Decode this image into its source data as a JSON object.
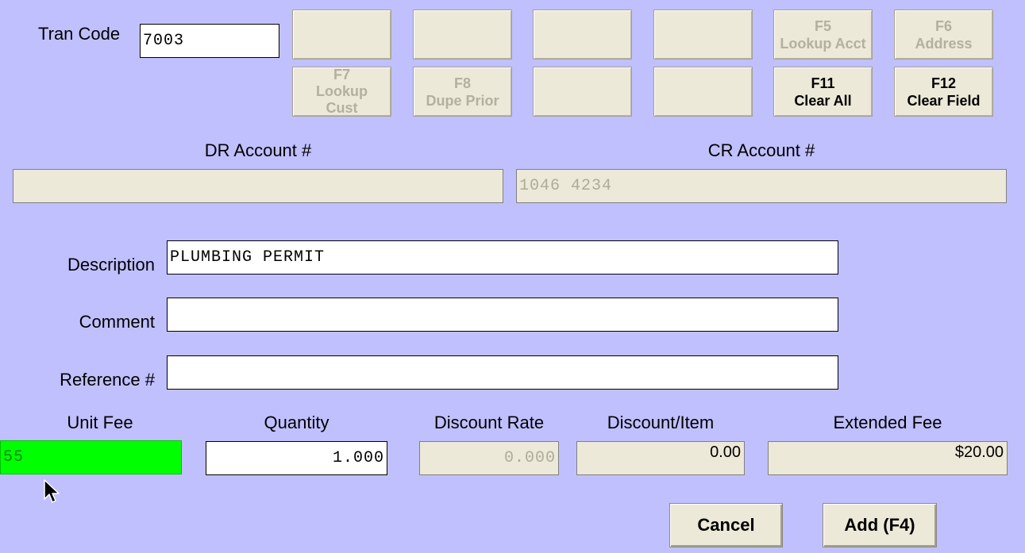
{
  "tran_code": {
    "label": "Tran Code",
    "value": "7003"
  },
  "function_keys": [
    {
      "key": "",
      "label": "",
      "enabled": false
    },
    {
      "key": "",
      "label": "",
      "enabled": false
    },
    {
      "key": "",
      "label": "",
      "enabled": false
    },
    {
      "key": "",
      "label": "",
      "enabled": false
    },
    {
      "key": "F5",
      "label": "Lookup Acct",
      "enabled": false
    },
    {
      "key": "F6",
      "label": "Address",
      "enabled": false
    },
    {
      "key": "F7",
      "label": "Lookup Cust",
      "enabled": false
    },
    {
      "key": "F8",
      "label": "Dupe Prior",
      "enabled": false
    },
    {
      "key": "",
      "label": "",
      "enabled": false
    },
    {
      "key": "",
      "label": "",
      "enabled": false
    },
    {
      "key": "F11",
      "label": "Clear All",
      "enabled": true
    },
    {
      "key": "F12",
      "label": "Clear Field",
      "enabled": true
    }
  ],
  "accounts": {
    "dr_label": "DR Account #",
    "dr_value": "",
    "cr_label": "CR Account #",
    "cr_value": "1046 4234"
  },
  "form": {
    "description_label": "Description",
    "description_value": "PLUMBING PERMIT",
    "comment_label": "Comment",
    "comment_value": "",
    "reference_label": "Reference #",
    "reference_value": ""
  },
  "fees": {
    "unit_fee_label": "Unit Fee",
    "unit_fee_value": "55",
    "quantity_label": "Quantity",
    "quantity_value": "1.000",
    "discount_rate_label": "Discount Rate",
    "discount_rate_value": "0.000",
    "discount_item_label": "Discount/Item",
    "discount_item_value": "0.00",
    "extended_fee_label": "Extended Fee",
    "extended_fee_value": "$20.00"
  },
  "actions": {
    "cancel_label": "Cancel",
    "add_label": "Add (F4)"
  },
  "colors": {
    "background": "#c0c0ff",
    "button_face": "#ece9d8",
    "unit_fee_highlight": "#00ff00",
    "disabled_text": "#b4b0a0"
  }
}
